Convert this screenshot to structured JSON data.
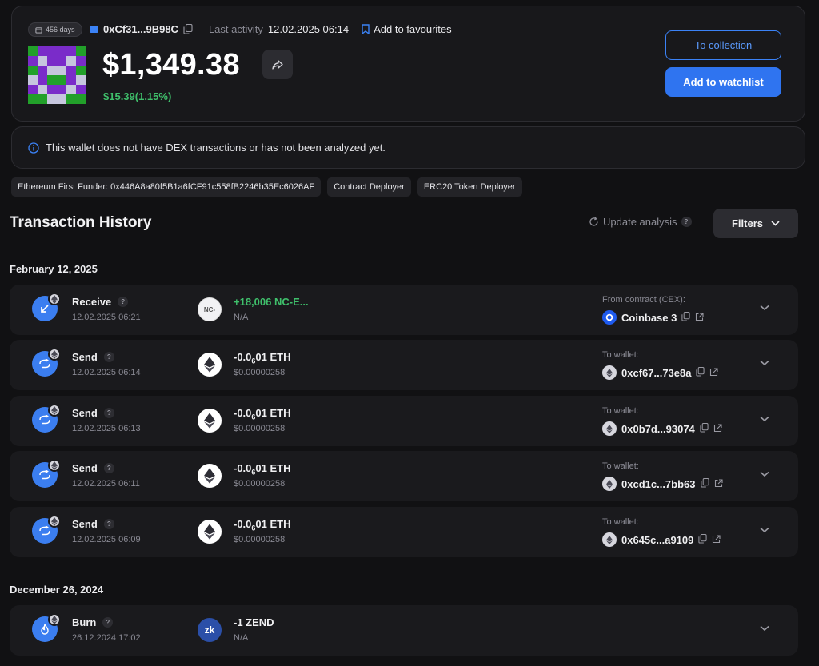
{
  "header": {
    "days_badge": "456 days",
    "address_short": "0xCf31...9B98C",
    "last_activity_label": "Last activity",
    "last_activity_value": "12.02.2025 06:14",
    "favourites_label": "Add to favourites",
    "balance": "$1,349.38",
    "change": "$15.39(1.15%)",
    "collection_button": "To collection",
    "watchlist_button": "Add to watchlist"
  },
  "notice": {
    "text": "This wallet does not have DEX transactions or has not been analyzed yet."
  },
  "tags": [
    "Ethereum First Funder: 0x446A8a80f5B1a6fCF91c558fB2246b35Ec6026AF",
    "Contract Deployer",
    "ERC20 Token Deployer"
  ],
  "history": {
    "title": "Transaction History",
    "update_label": "Update analysis",
    "filters_label": "Filters",
    "groups": [
      {
        "date": "February 12, 2025",
        "rows": [
          {
            "type": "Receive",
            "time": "12.02.2025 06:21",
            "token_icon": "NC-",
            "amount": "+18,006 NC-E...",
            "usd": "N/A",
            "cp_label": "From contract (CEX):",
            "cp_value": "Coinbase 3"
          },
          {
            "type": "Send",
            "time": "12.02.2025 06:14",
            "token_icon": "eth",
            "amount_main": "-0.0",
            "amount_sub": "6",
            "amount_tail": "01 ETH",
            "usd": "$0.00000258",
            "cp_label": "To wallet:",
            "cp_value": "0xcf67...73e8a"
          },
          {
            "type": "Send",
            "time": "12.02.2025 06:13",
            "token_icon": "eth",
            "amount_main": "-0.0",
            "amount_sub": "6",
            "amount_tail": "01 ETH",
            "usd": "$0.00000258",
            "cp_label": "To wallet:",
            "cp_value": "0x0b7d...93074"
          },
          {
            "type": "Send",
            "time": "12.02.2025 06:11",
            "token_icon": "eth",
            "amount_main": "-0.0",
            "amount_sub": "6",
            "amount_tail": "01 ETH",
            "usd": "$0.00000258",
            "cp_label": "To wallet:",
            "cp_value": "0xcd1c...7bb63"
          },
          {
            "type": "Send",
            "time": "12.02.2025 06:09",
            "token_icon": "eth",
            "amount_main": "-0.0",
            "amount_sub": "6",
            "amount_tail": "01 ETH",
            "usd": "$0.00000258",
            "cp_label": "To wallet:",
            "cp_value": "0x645c...a9109"
          }
        ]
      },
      {
        "date": "December 26, 2024",
        "rows": [
          {
            "type": "Burn",
            "time": "26.12.2024 17:02",
            "token_icon": "zk",
            "amount": "-1 ZEND",
            "usd": "N/A"
          }
        ]
      }
    ]
  },
  "colors": {
    "accent": "#2f74f0",
    "positive": "#3fbf6b",
    "background": "#111113"
  }
}
